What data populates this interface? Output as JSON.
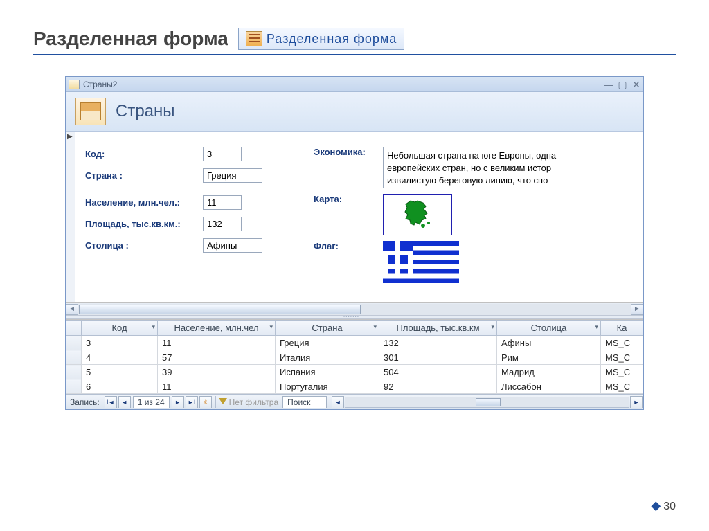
{
  "slide": {
    "title": "Разделенная форма",
    "number": "30"
  },
  "ribbon": {
    "label": "Разделенная форма"
  },
  "window": {
    "title": "Страны2",
    "form_title": "Страны",
    "labels": {
      "kod": "Код:",
      "country": "Страна :",
      "population": "Население, млн.чел.:",
      "area": "Площадь, тыс.кв.км.:",
      "capital": "Столица :",
      "economy": "Экономика:",
      "map": "Карта:",
      "flag": "Флаг:"
    },
    "values": {
      "kod": "3",
      "country": "Греция",
      "population": "11",
      "area": "132",
      "capital": "Афины",
      "economy": "Небольшая страна на юге Европы, одна европейских стран, но с великим истор извилистую береговую линию, что спо"
    }
  },
  "datasheet": {
    "columns": [
      "Код",
      "Население, млн.чел",
      "Страна",
      "Площадь, тыс.кв.км",
      "Столица",
      "Ка"
    ],
    "rows": [
      {
        "kod": "3",
        "pop": "11",
        "country": "Греция",
        "area": "132",
        "capital": "Афины",
        "k": "MS_C"
      },
      {
        "kod": "4",
        "pop": "57",
        "country": "Италия",
        "area": "301",
        "capital": "Рим",
        "k": "MS_C"
      },
      {
        "kod": "5",
        "pop": "39",
        "country": "Испания",
        "area": "504",
        "capital": "Мадрид",
        "k": "MS_C"
      },
      {
        "kod": "6",
        "pop": "11",
        "country": "Португалия",
        "area": "92",
        "capital": "Лиссабон",
        "k": "MS_C"
      }
    ]
  },
  "navbar": {
    "label": "Запись:",
    "position": "1 из 24",
    "filter": "Нет фильтра",
    "search": "Поиск"
  }
}
